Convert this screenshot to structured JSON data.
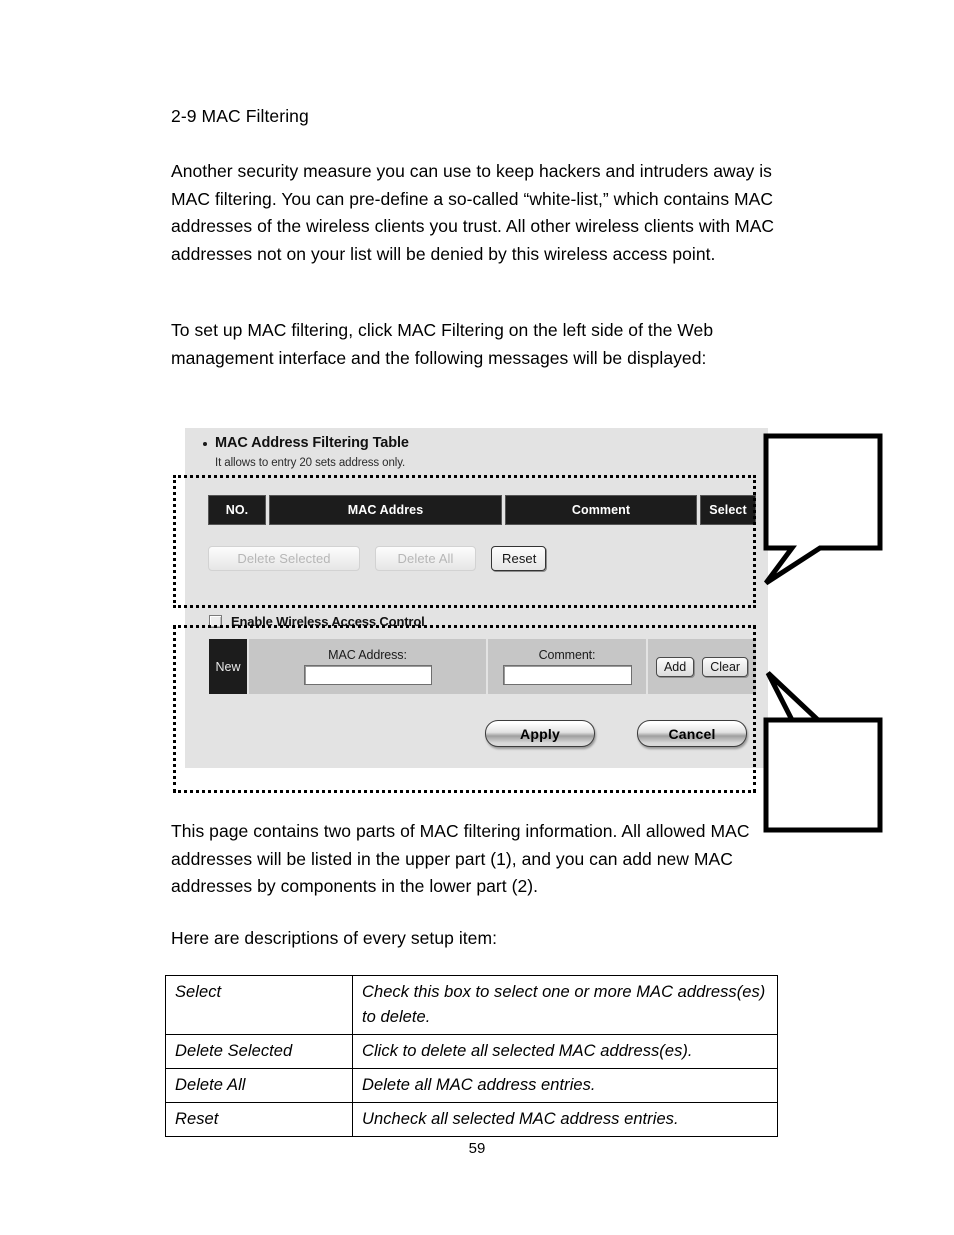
{
  "document": {
    "heading": "2-9 MAC Filtering",
    "paragraph_1": "Another security measure you can use to keep hackers and intruders away is MAC filtering. You can pre-define a so-called “white-list,” which contains MAC addresses of the wireless clients you trust. All other wireless clients with MAC addresses not on your list will be denied by this wireless access point.",
    "paragraph_2": "To set up MAC filtering, click MAC Filtering on the left side of the Web management interface and the following messages will be displayed:",
    "paragraph_3": "This page contains two parts of MAC filtering information. All allowed MAC addresses will be listed in the upper part (1), and you can add new MAC addresses by components in the lower part (2).",
    "paragraph_4": "Here are descriptions of every setup item:",
    "page_number": "59"
  },
  "ui_screenshot": {
    "section_title": "MAC Address Filtering Table",
    "section_subtitle": "It allows to entry 20 sets address only.",
    "table_headers": [
      "NO.",
      "MAC Addres",
      "Comment",
      "Select"
    ],
    "table_rows": [],
    "buttons": {
      "delete_selected": "Delete Selected",
      "delete_all": "Delete All",
      "reset": "Reset",
      "add": "Add",
      "clear": "Clear",
      "apply": "Apply",
      "cancel": "Cancel"
    },
    "enable_checkbox": {
      "label": "Enable Wireless Access Control",
      "checked": false
    },
    "new_entry": {
      "row_label": "New",
      "mac_label": "MAC Address:",
      "mac_value": "",
      "comment_label": "Comment:",
      "comment_value": ""
    },
    "colors": {
      "panel_background": "#e3e3e3",
      "header_row": "#1c1c1c",
      "field_row": "#c6c6c6",
      "header_text": "#ffffff"
    }
  },
  "callouts": [
    {
      "name": "callout-upper",
      "text": ""
    },
    {
      "name": "callout-lower",
      "text": ""
    }
  ],
  "description_table": {
    "rows": [
      {
        "term": "Select",
        "description": "Check this box to select one or more MAC address(es) to delete."
      },
      {
        "term": "Delete Selected",
        "description": "Click to delete all selected MAC address(es)."
      },
      {
        "term": "Delete All",
        "description": "Delete all MAC address entries."
      },
      {
        "term": "Reset",
        "description": "Uncheck all selected MAC address entries."
      }
    ]
  }
}
